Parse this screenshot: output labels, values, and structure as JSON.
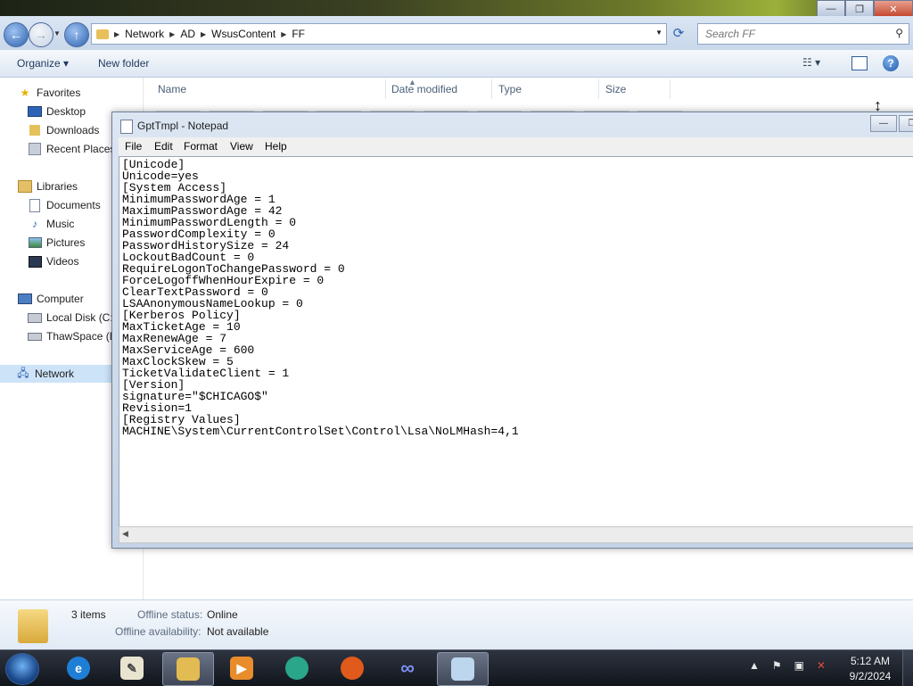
{
  "explorer": {
    "breadcrumb": [
      "Network",
      "AD",
      "WsusContent",
      "FF"
    ],
    "search_placeholder": "Search FF",
    "toolbar": {
      "organize_label": "Organize ▾",
      "new_folder_label": "New folder"
    },
    "nav": {
      "favorites": "Favorites",
      "desktop": "Desktop",
      "downloads": "Downloads",
      "recent_places": "Recent Places",
      "libraries": "Libraries",
      "documents": "Documents",
      "music": "Music",
      "pictures": "Pictures",
      "videos": "Videos",
      "computer": "Computer",
      "local_disk": "Local Disk (C:)",
      "thawspace": "ThawSpace (E:)",
      "network": "Network"
    },
    "columns": [
      "Name",
      "Date modified",
      "Type",
      "Size"
    ],
    "details": {
      "item_count": "3 items",
      "offline_status_label": "Offline status:",
      "offline_status_value": "Online",
      "offline_availability_label": "Offline availability:",
      "offline_availability_value": "Not available"
    }
  },
  "notepad": {
    "title": "GptTmpl - Notepad",
    "menu": [
      "File",
      "Edit",
      "Format",
      "View",
      "Help"
    ],
    "content": "[Unicode]\nUnicode=yes\n[System Access]\nMinimumPasswordAge = 1\nMaximumPasswordAge = 42\nMinimumPasswordLength = 0\nPasswordComplexity = 0\nPasswordHistorySize = 24\nLockoutBadCount = 0\nRequireLogonToChangePassword = 0\nForceLogoffWhenHourExpire = 0\nClearTextPassword = 0\nLSAAnonymousNameLookup = 0\n[Kerberos Policy]\nMaxTicketAge = 10\nMaxRenewAge = 7\nMaxServiceAge = 600\nMaxClockSkew = 5\nTicketValidateClient = 1\n[Version]\nsignature=\"$CHICAGO$\"\nRevision=1\n[Registry Values]\nMACHINE\\System\\CurrentControlSet\\Control\\Lsa\\NoLMHash=4,1"
  },
  "taskbar": {
    "clock_time": "5:12 AM",
    "clock_date": "9/2/2024",
    "apps": [
      "start",
      "internet-explorer",
      "notepad",
      "windows-explorer",
      "media-player",
      "network-globe",
      "firefox",
      "infinity-app",
      "notepad-active"
    ]
  }
}
